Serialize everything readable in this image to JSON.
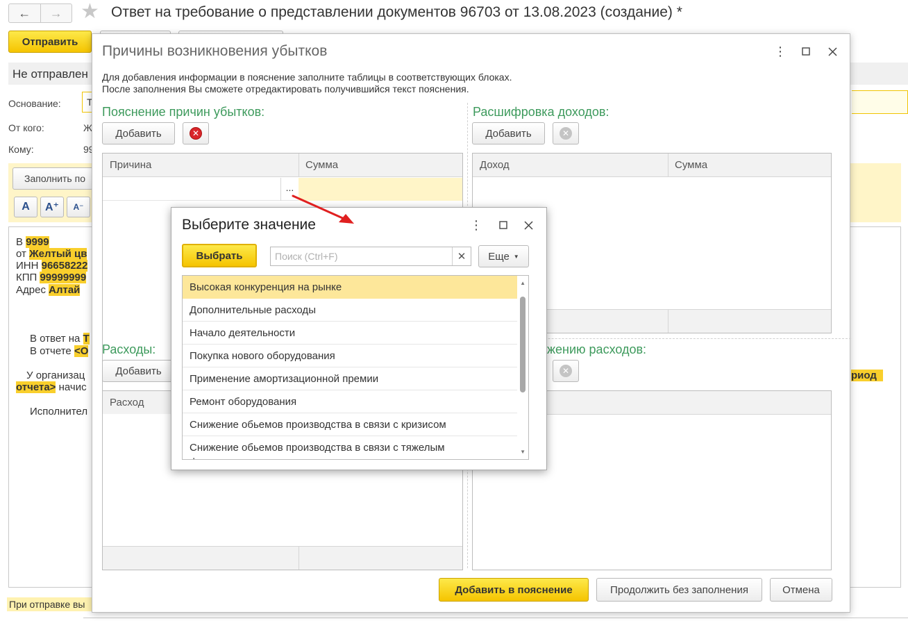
{
  "background": {
    "title": "Ответ на требование о представлении документов 96703 от 13.08.2023 (создание) *",
    "send_label": "Отправить",
    "status": "Не отправлен",
    "fields": [
      {
        "label": "Основание:",
        "value": "Т"
      },
      {
        "label": "От кого:",
        "value": "Ж"
      },
      {
        "label": "Кому:",
        "value": "99"
      }
    ],
    "fill_label": "Заполнить по",
    "format_buttons": [
      "A",
      "A⁺",
      "A⁻"
    ],
    "doc_lines": {
      "l1_prefix": "В ",
      "l1_hl": "9999",
      "l2_prefix": "от ",
      "l2_hl": "Желтый цв",
      "l3_prefix": "ИНН ",
      "l3_hl": "96658222",
      "l4_prefix": "КПП ",
      "l4_hl": "99999999",
      "l5_prefix": "Адрес ",
      "l5_hl": "Алтай",
      "l6_prefix": "В ответ на ",
      "l6_hl": "Т",
      "l7_prefix": "В отчете ",
      "l7_hl": "<О",
      "l8_text": "У организац",
      "l9_hl": "отчета>",
      "l9_text": " начис",
      "l10_text": "Исполнител",
      "right_hl": "риод"
    },
    "bottom_note": "При отправке вы"
  },
  "modal": {
    "title": "Причины возникновения убытков",
    "info_line1": "Для добавления информации в пояснение заполните таблицы в соответствующих блоках.",
    "info_line2": "После заполнения Вы сможете отредактировать получившийся текст пояснения.",
    "add_label": "Добавить",
    "sections": {
      "reasons": {
        "title": "Пояснение причин убытков:",
        "col1": "Причина",
        "col2": "Сумма",
        "ellipsis": "..."
      },
      "income": {
        "title": "Расшифровка доходов:",
        "col1": "Доход",
        "col2": "Сумма"
      },
      "expenses": {
        "title": "Расходы:",
        "col1": "Расход"
      },
      "reduction": {
        "title": "жению расходов:"
      }
    },
    "buttons": {
      "add_to_explanation": "Добавить в пояснение",
      "continue_without": "Продолжить без заполнения",
      "cancel": "Отмена"
    }
  },
  "popup": {
    "title": "Выберите значение",
    "select_label": "Выбрать",
    "search_placeholder": "Поиск (Ctrl+F)",
    "more_label": "Еще",
    "items": [
      "Высокая конкуренция на рынке",
      "Дополнительные расходы",
      "Начало деятельности",
      "Покупка нового оборудования",
      "Применение амортизационной премии",
      "Ремонт оборудования",
      "Снижение обьемов производства в связи с кризисом",
      "Снижение обьемов производства в связи с тяжелым финансовым состоянием"
    ],
    "selected_index": 0
  },
  "colors": {
    "accent_yellow": "#f5c400",
    "section_green": "#3d9a5c",
    "delete_red": "#d9262b",
    "selection": "#fde79a",
    "arrow_red": "#e02020"
  }
}
